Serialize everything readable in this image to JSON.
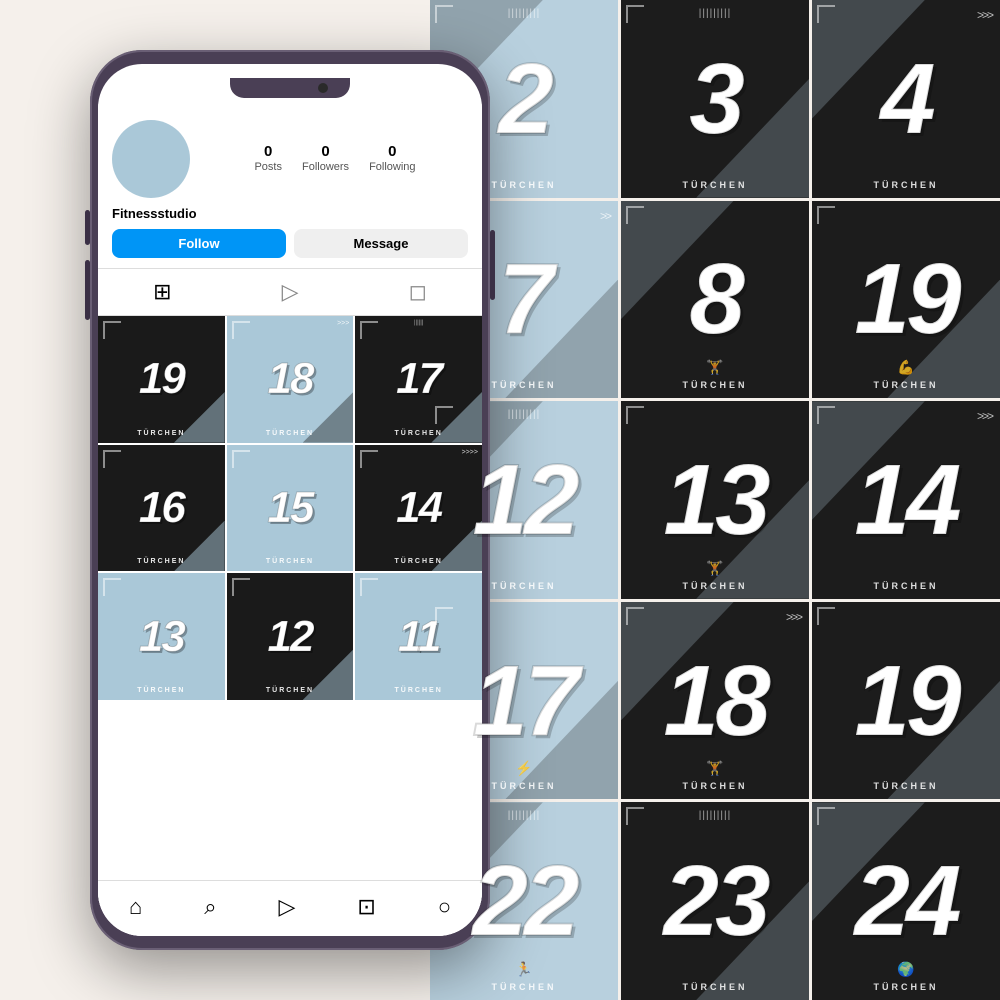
{
  "background": "#f5f0eb",
  "phone": {
    "profile": {
      "avatar_color": "#aac8d8",
      "username": "Fitnessstudio",
      "posts_label": "Posts",
      "posts_count": "0",
      "followers_label": "Followers",
      "followers_count": "0",
      "following_label": "Following",
      "following_count": "0",
      "follow_btn": "Follow",
      "message_btn": "Message"
    },
    "grid_tiles": [
      {
        "num": "19",
        "scheme": "dark"
      },
      {
        "num": "18",
        "scheme": "light"
      },
      {
        "num": "17",
        "scheme": "dark"
      },
      {
        "num": "16",
        "scheme": "dark"
      },
      {
        "num": "15",
        "scheme": "light"
      },
      {
        "num": "14",
        "scheme": "dark"
      },
      {
        "num": "13",
        "scheme": "light"
      },
      {
        "num": "12",
        "scheme": "dark"
      },
      {
        "num": "11",
        "scheme": "light"
      }
    ],
    "label": "TÜRCHEN"
  },
  "bg_grid": {
    "tiles": [
      {
        "num": "2",
        "scheme": "light",
        "accent": "tl",
        "deco": "lines"
      },
      {
        "num": "3",
        "scheme": "dark",
        "accent": "br",
        "deco": "lines"
      },
      {
        "num": "4",
        "scheme": "dark",
        "accent": "br",
        "deco": "arrows"
      },
      {
        "num": "7",
        "scheme": "light",
        "accent": "br",
        "deco": "arrows"
      },
      {
        "num": "8",
        "scheme": "dark",
        "accent": "tl",
        "deco": "none"
      },
      {
        "num": "19",
        "scheme": "dark",
        "accent": "br",
        "deco": "arrows"
      },
      {
        "num": "12",
        "scheme": "light",
        "accent": "tl",
        "deco": "lines"
      },
      {
        "num": "13",
        "scheme": "dark",
        "accent": "br",
        "deco": "arrows"
      },
      {
        "num": "14",
        "scheme": "dark",
        "accent": "tl",
        "deco": "arrows"
      },
      {
        "num": "17",
        "scheme": "light",
        "accent": "br",
        "deco": "none"
      },
      {
        "num": "18",
        "scheme": "dark",
        "accent": "tl",
        "deco": "arrows"
      },
      {
        "num": "19",
        "scheme": "dark",
        "accent": "br",
        "deco": "lines"
      },
      {
        "num": "22",
        "scheme": "light",
        "accent": "tl",
        "deco": "lines"
      },
      {
        "num": "23",
        "scheme": "dark",
        "accent": "br",
        "deco": "lines"
      },
      {
        "num": "24",
        "scheme": "dark",
        "accent": "br",
        "deco": "none"
      }
    ],
    "label": "TÜRCHEN"
  }
}
